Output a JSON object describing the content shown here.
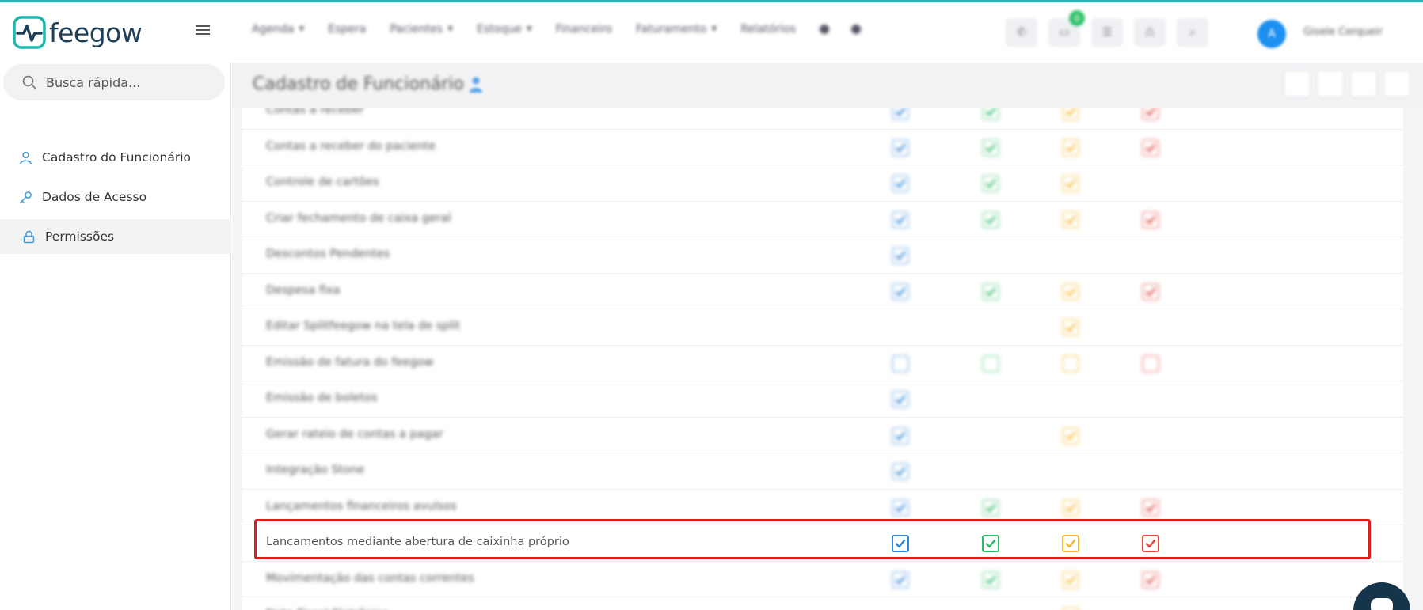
{
  "header": {
    "logo_text": "feegow",
    "nav": [
      {
        "label": "Agenda",
        "dropdown": true
      },
      {
        "label": "Espera",
        "dropdown": false
      },
      {
        "label": "Pacientes",
        "dropdown": true
      },
      {
        "label": "Estoque",
        "dropdown": true
      },
      {
        "label": "Financeiro",
        "dropdown": false
      },
      {
        "label": "Faturamento",
        "dropdown": true
      },
      {
        "label": "Relatórios",
        "dropdown": false
      }
    ],
    "notification_count": "0",
    "avatar_initial": "A",
    "user_name": "Gisele Cerqueir"
  },
  "sidebar": {
    "search_placeholder": "Busca rápida...",
    "items": [
      {
        "label": "Cadastro do Funcionário",
        "icon": "user-icon",
        "active": false
      },
      {
        "label": "Dados de Acesso",
        "icon": "key-icon",
        "active": false
      },
      {
        "label": "Permissões",
        "icon": "lock-icon",
        "active": true
      }
    ]
  },
  "page": {
    "title": "Cadastro de Funcionário"
  },
  "colors": {
    "blue": "#2f86d6",
    "green": "#2dbb63",
    "yellow": "#f5b82a",
    "red": "#e2473f",
    "highlight": "#e21b1b",
    "brand_teal": "#1fb8b0"
  },
  "permissions": {
    "rows": [
      {
        "label": "Contas a receber",
        "blur": true,
        "cells": [
          "on",
          "on",
          "on",
          "on"
        ]
      },
      {
        "label": "Contas a receber do paciente",
        "blur": true,
        "cells": [
          "on",
          "on",
          "on",
          "on"
        ]
      },
      {
        "label": "Controle de cartões",
        "blur": true,
        "cells": [
          "on",
          "on",
          "on",
          ""
        ]
      },
      {
        "label": "Criar fechamento de caixa geral",
        "blur": true,
        "cells": [
          "on",
          "on",
          "on",
          "on"
        ]
      },
      {
        "label": "Descontos Pendentes",
        "blur": true,
        "cells": [
          "on",
          "",
          "",
          ""
        ]
      },
      {
        "label": "Despesa fixa",
        "blur": true,
        "cells": [
          "on",
          "on",
          "on",
          "on"
        ]
      },
      {
        "label": "Editar Splitfeegow na tela de split",
        "blur": true,
        "cells": [
          "",
          "",
          "on",
          ""
        ]
      },
      {
        "label": "Emissão de fatura do feegow",
        "blur": true,
        "cells": [
          "off",
          "off",
          "off",
          "off"
        ]
      },
      {
        "label": "Emissão de boletos",
        "blur": true,
        "cells": [
          "on",
          "",
          "",
          ""
        ]
      },
      {
        "label": "Gerar rateio de contas a pagar",
        "blur": true,
        "cells": [
          "on",
          "",
          "on",
          ""
        ]
      },
      {
        "label": "Integração Stone",
        "blur": true,
        "cells": [
          "on",
          "",
          "",
          ""
        ]
      },
      {
        "label": "Lançamentos financeiros avulsos",
        "blur": true,
        "cells": [
          "on",
          "on",
          "on",
          "on"
        ]
      },
      {
        "label": "Lançamentos mediante abertura de caixinha próprio",
        "blur": false,
        "cells": [
          "on",
          "on",
          "on",
          "on"
        ]
      },
      {
        "label": "Movimentação das contas correntes",
        "blur": true,
        "cells": [
          "on",
          "on",
          "on",
          "on"
        ]
      },
      {
        "label": "Nota Fiscal Eletrônica",
        "blur": true,
        "cells": [
          "",
          "",
          "on",
          ""
        ]
      }
    ]
  }
}
